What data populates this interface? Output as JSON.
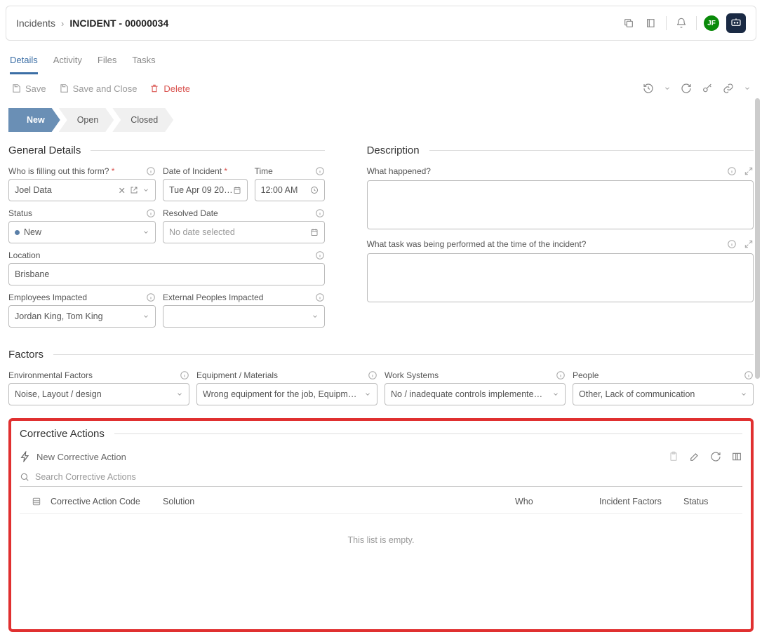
{
  "breadcrumb": {
    "root": "Incidents",
    "current": "INCIDENT - 00000034"
  },
  "avatar": "JF",
  "tabs": [
    "Details",
    "Activity",
    "Files",
    "Tasks"
  ],
  "actions": {
    "save": "Save",
    "save_close": "Save and Close",
    "delete": "Delete"
  },
  "stages": [
    "New",
    "Open",
    "Closed"
  ],
  "sections": {
    "general": "General Details",
    "description": "Description",
    "factors": "Factors",
    "corrective": "Corrective Actions"
  },
  "fields": {
    "filler": {
      "label": "Who is filling out this form?",
      "value": "Joel Data"
    },
    "date_incident": {
      "label": "Date of Incident",
      "value": "Tue Apr 09 20…"
    },
    "time": {
      "label": "Time",
      "value": "12:00 AM"
    },
    "status": {
      "label": "Status",
      "value": "New"
    },
    "resolved": {
      "label": "Resolved Date",
      "value": "No date selected"
    },
    "location": {
      "label": "Location",
      "value": "Brisbane"
    },
    "emp_impacted": {
      "label": "Employees Impacted",
      "value": "Jordan King, Tom King"
    },
    "ext_impacted": {
      "label": "External Peoples Impacted",
      "value": ""
    },
    "what_happened": {
      "label": "What happened?"
    },
    "what_task": {
      "label": "What task was being performed at the time of the incident?"
    }
  },
  "factors": {
    "env": {
      "label": "Environmental Factors",
      "value": "Noise, Layout / design"
    },
    "equip": {
      "label": "Equipment / Materials",
      "value": "Wrong equipment for the job, Equipm…"
    },
    "work": {
      "label": "Work Systems",
      "value": "No / inadequate controls implemente…"
    },
    "people": {
      "label": "People",
      "value": "Other, Lack of communication"
    }
  },
  "corrective": {
    "new_label": "New Corrective Action",
    "search_placeholder": "Search Corrective Actions",
    "columns": {
      "code": "Corrective Action Code",
      "solution": "Solution",
      "who": "Who",
      "factors": "Incident Factors",
      "status": "Status"
    },
    "empty": "This list is empty."
  }
}
